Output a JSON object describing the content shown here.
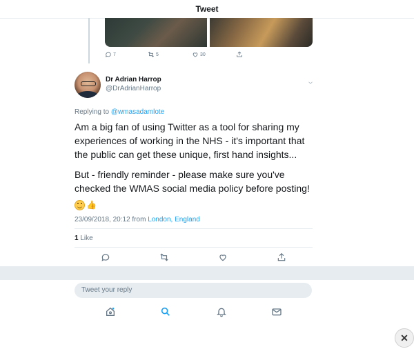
{
  "header": {
    "title": "Tweet"
  },
  "previous_tweet": {
    "reply_count": "7",
    "retweet_count": "5",
    "like_count": "30"
  },
  "tweet": {
    "name": "Dr Adrian Harrop",
    "handle": "@DrAdrianHarrop",
    "replying_prefix": "Replying to ",
    "replying_to": "@wmasadamlote",
    "paragraph1": "Am a big fan of using Twitter as a tool for sharing my experiences of working in the NHS - it's important that the public can get these unique, first hand insights...",
    "paragraph2": "But - friendly reminder - please make sure you've checked the WMAS social media policy before posting!",
    "emoji": "smiling-face, thumbs-up",
    "timestamp": "23/09/2018, 20:12 from ",
    "location": "London, England",
    "like_count": "1",
    "like_label": " Like"
  },
  "reply": {
    "placeholder": "Tweet your reply"
  },
  "icons": {
    "reply": "comment-icon",
    "retweet": "retweet-icon",
    "like": "heart-icon",
    "share": "share-icon",
    "home": "home-icon",
    "search": "search-icon",
    "notifications": "bell-icon",
    "messages": "envelope-icon",
    "close": "close-icon"
  },
  "colors": {
    "accent": "#1da1f2",
    "muted": "#657786",
    "divider": "#e6ecf0"
  }
}
